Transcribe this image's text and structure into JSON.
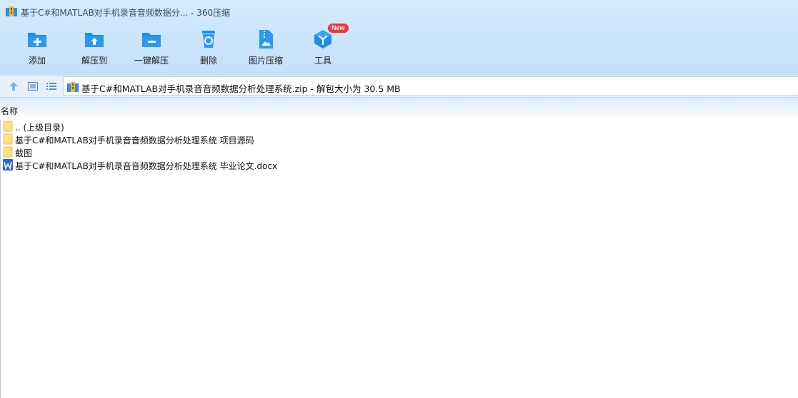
{
  "window": {
    "title": "基于C#和MATLAB对手机录音音频数据分... - 360压缩"
  },
  "toolbar": {
    "items": [
      {
        "label": "添加",
        "icon": "add-folder-icon"
      },
      {
        "label": "解压到",
        "icon": "extract-to-icon"
      },
      {
        "label": "一键解压",
        "icon": "one-click-extract-icon"
      },
      {
        "label": "删除",
        "icon": "delete-bin-icon"
      },
      {
        "label": "图片压缩",
        "icon": "image-compress-icon"
      },
      {
        "label": "工具",
        "icon": "tools-cube-icon",
        "badge": "New"
      }
    ],
    "accent_color": "#1e8ce8",
    "badge_color": "#f2353c"
  },
  "navbar": {
    "path": "基于C#和MATLAB对手机录音音频数据分析处理系统.zip - 解包大小为 30.5 MB"
  },
  "list": {
    "column_name": "名称",
    "rows": [
      {
        "name": ".. (上级目录)",
        "type": "folder"
      },
      {
        "name": "基于C#和MATLAB对手机录音音频数据分析处理系统 项目源码",
        "type": "folder"
      },
      {
        "name": "截图",
        "type": "folder"
      },
      {
        "name": "基于C#和MATLAB对手机录音音频数据分析处理系统 毕业论文.docx",
        "type": "word"
      }
    ]
  }
}
